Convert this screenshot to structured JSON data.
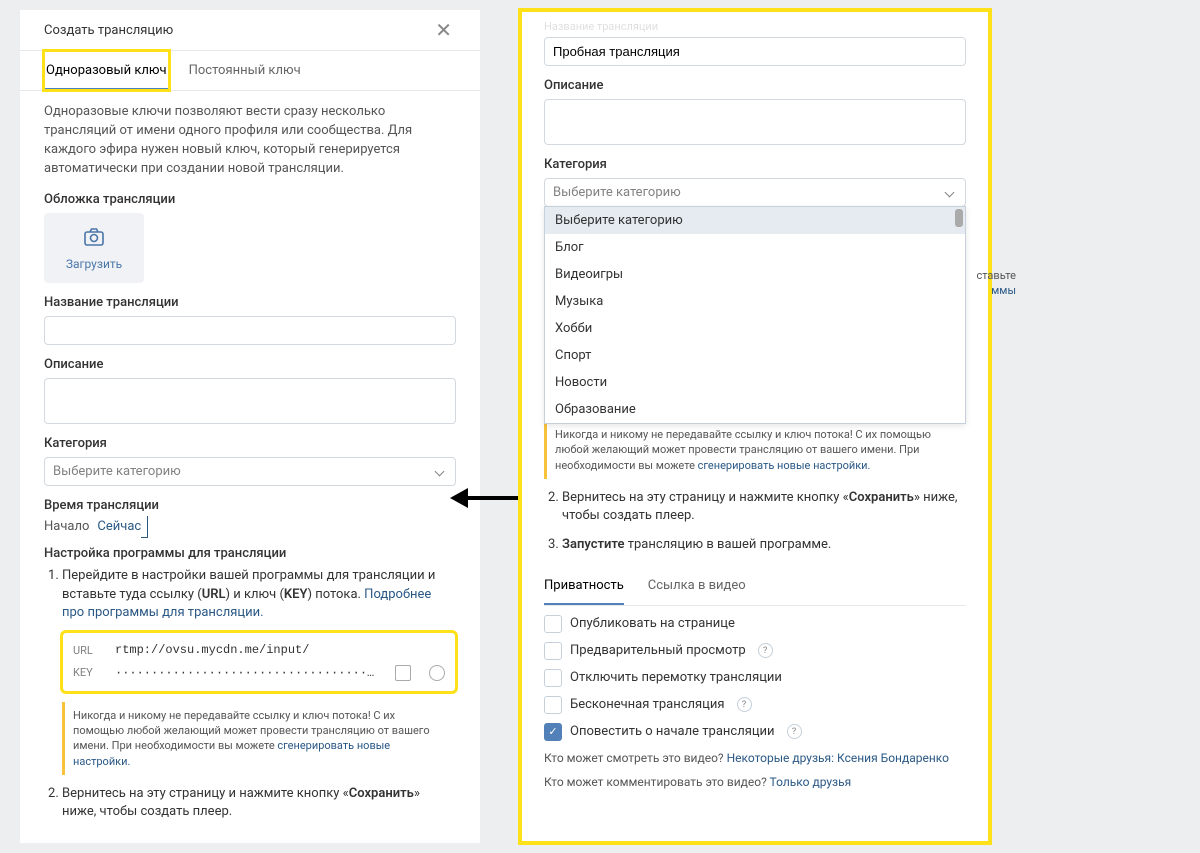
{
  "left": {
    "title": "Создать трансляцию",
    "tabs": {
      "onetime": "Одноразовый ключ",
      "permanent": "Постоянный ключ"
    },
    "intro": "Одноразовые ключи позволяют вести сразу несколько трансляций от имени одного профиля или сообщества. Для каждого эфира нужен новый ключ, который генерируется автоматически при создании новой трансляции.",
    "cover_label": "Обложка трансляции",
    "upload": "Загрузить",
    "name_label": "Название трансляции",
    "desc_label": "Описание",
    "cat_label": "Категория",
    "cat_placeholder": "Выберите категорию",
    "time_label": "Время трансляции",
    "start_label": "Начало",
    "start_value": "Сейчас",
    "setup_label": "Настройка программы для трансляции",
    "step1_a": "Перейдите в настройки вашей программы для трансляции и вставьте туда ссылку (",
    "step1_url": "URL",
    "step1_b": ") и ключ (",
    "step1_key": "KEY",
    "step1_c": ") потока. ",
    "step1_link": "Подробнее про программы для трансляции.",
    "url_k": "URL",
    "url_v": "rtmp://ovsu.mycdn.me/input/",
    "key_k": "KEY",
    "key_v": "········································",
    "warn_a": "Никогда и никому не передавайте ссылку и ключ потока! С их помощью любой желающий может провести трансляцию от вашего имени. При необходимости вы можете ",
    "warn_link": "сгенерировать новые настройки.",
    "step2_a": "Вернитесь на эту страницу и нажмите кнопку «",
    "step2_b": "Сохранить",
    "step2_c": "» ниже, чтобы создать плеер."
  },
  "right": {
    "cut_label": "Название трансляции",
    "name_value": "Пробная трансляция",
    "desc_label": "Описание",
    "cat_label": "Категория",
    "cat_placeholder": "Выберите категорию",
    "categories": [
      "Выберите категорию",
      "Блог",
      "Видеоигры",
      "Музыка",
      "Хобби",
      "Спорт",
      "Новости",
      "Образование"
    ],
    "hint_tail": "ставьте ммы",
    "warn_a": "Никогда и никому не передавайте ссылку и ключ потока! С их помощью любой желающий может провести трансляцию от вашего имени. При необходимости вы можете ",
    "warn_link": "сгенерировать новые настройки.",
    "step2_a": "Вернитесь на эту страницу и нажмите кнопку «",
    "step2_b": "Сохранить",
    "step2_c": "» ниже, чтобы создать плеер.",
    "step3_a": "Запустите",
    "step3_b": " трансляцию в вашей программе.",
    "tab_privacy": "Приватность",
    "tab_link": "Ссылка в видео",
    "chk": {
      "publish": "Опубликовать на странице",
      "preview": "Предварительный просмотр",
      "norewind": "Отключить перемотку трансляции",
      "infinite": "Бесконечная трансляция",
      "notify": "Оповестить о начале трансляции"
    },
    "vis_q": "Кто может смотреть это видео? ",
    "vis_a": "Некоторые друзья: Ксения Бондаренко",
    "com_q": "Кто может комментировать это видео? ",
    "com_a": "Только друзья"
  }
}
